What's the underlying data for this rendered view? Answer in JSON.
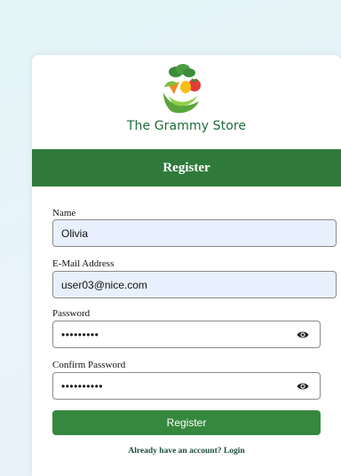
{
  "brand": {
    "name": "The Grammy Store",
    "logo_icon": "vegetable-basket-logo"
  },
  "header": {
    "title": "Register"
  },
  "form": {
    "name": {
      "label": "Name",
      "value": "Olivia"
    },
    "email": {
      "label": "E-Mail Address",
      "value": "user03@nice.com"
    },
    "password": {
      "label": "Password",
      "value": "•••••••••",
      "toggle_icon": "eye-icon"
    },
    "confirm_password": {
      "label": "Confirm Password",
      "value": "••••••••••",
      "toggle_icon": "eye-icon"
    },
    "submit_label": "Register",
    "login_prompt": "Already have an account? Login"
  },
  "colors": {
    "primary_green": "#2f7a3b",
    "button_green": "#36883e",
    "autofill_bg": "#e8f0fe"
  }
}
